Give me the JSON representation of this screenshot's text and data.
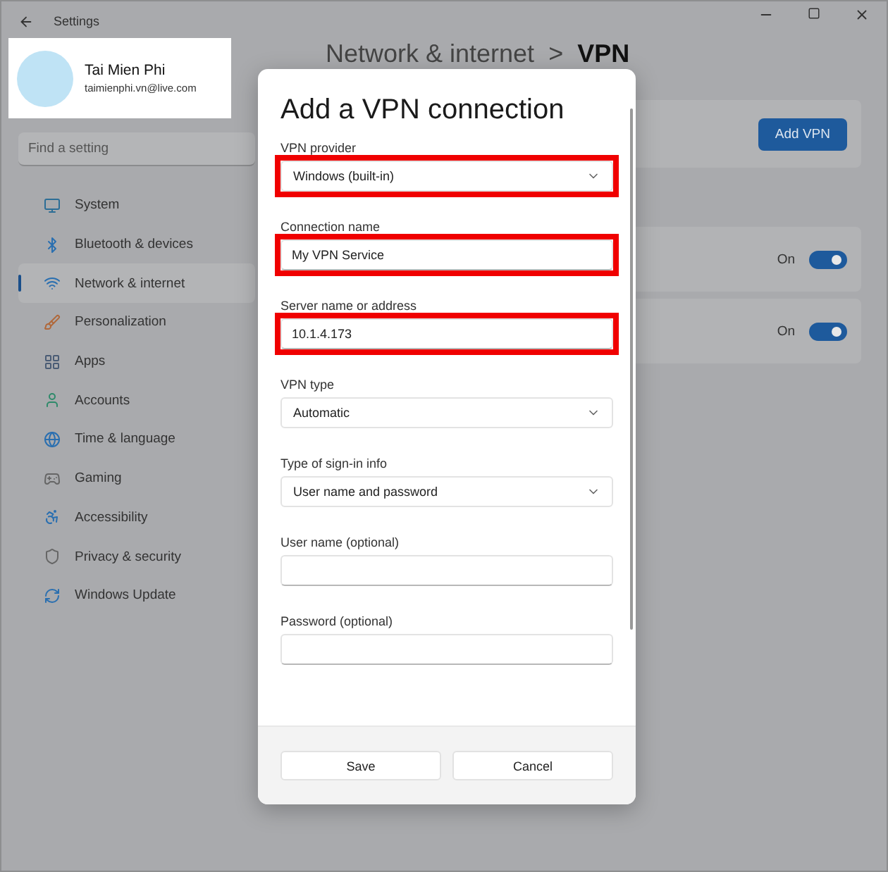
{
  "window": {
    "title": "Settings"
  },
  "profile": {
    "name": "Tai Mien Phi",
    "email": "taimienphi.vn@live.com"
  },
  "search": {
    "placeholder": "Find a setting"
  },
  "nav": [
    {
      "label": "System",
      "selected": false
    },
    {
      "label": "Bluetooth & devices",
      "selected": false
    },
    {
      "label": "Network & internet",
      "selected": true
    },
    {
      "label": "Personalization",
      "selected": false
    },
    {
      "label": "Apps",
      "selected": false
    },
    {
      "label": "Accounts",
      "selected": false
    },
    {
      "label": "Time & language",
      "selected": false
    },
    {
      "label": "Gaming",
      "selected": false
    },
    {
      "label": "Accessibility",
      "selected": false
    },
    {
      "label": "Privacy & security",
      "selected": false
    },
    {
      "label": "Windows Update",
      "selected": false
    }
  ],
  "breadcrumb": {
    "parent": "Network & internet",
    "separator": ">",
    "current": "VPN"
  },
  "vpn_card": {
    "button": "Add VPN"
  },
  "setting_rows": [
    {
      "state_label": "On",
      "on": true
    },
    {
      "state_label": "On",
      "on": true
    }
  ],
  "dialog": {
    "title": "Add a VPN connection",
    "fields": [
      {
        "kind": "dropdown",
        "label": "VPN provider",
        "value": "Windows (built-in)",
        "highlighted": true
      },
      {
        "kind": "text",
        "label": "Connection name",
        "value": "My VPN Service",
        "highlighted": true
      },
      {
        "kind": "text",
        "label": "Server name or address",
        "value": "10.1.4.173",
        "highlighted": true
      },
      {
        "kind": "dropdown",
        "label": "VPN type",
        "value": "Automatic",
        "highlighted": false
      },
      {
        "kind": "dropdown",
        "label": "Type of sign-in info",
        "value": "User name and password",
        "highlighted": false
      },
      {
        "kind": "text",
        "label": "User name (optional)",
        "highlighted": false
      },
      {
        "kind": "text",
        "label": "Password (optional)",
        "highlighted": false
      }
    ],
    "buttons": [
      {
        "label": "Save"
      },
      {
        "label": "Cancel"
      }
    ]
  }
}
